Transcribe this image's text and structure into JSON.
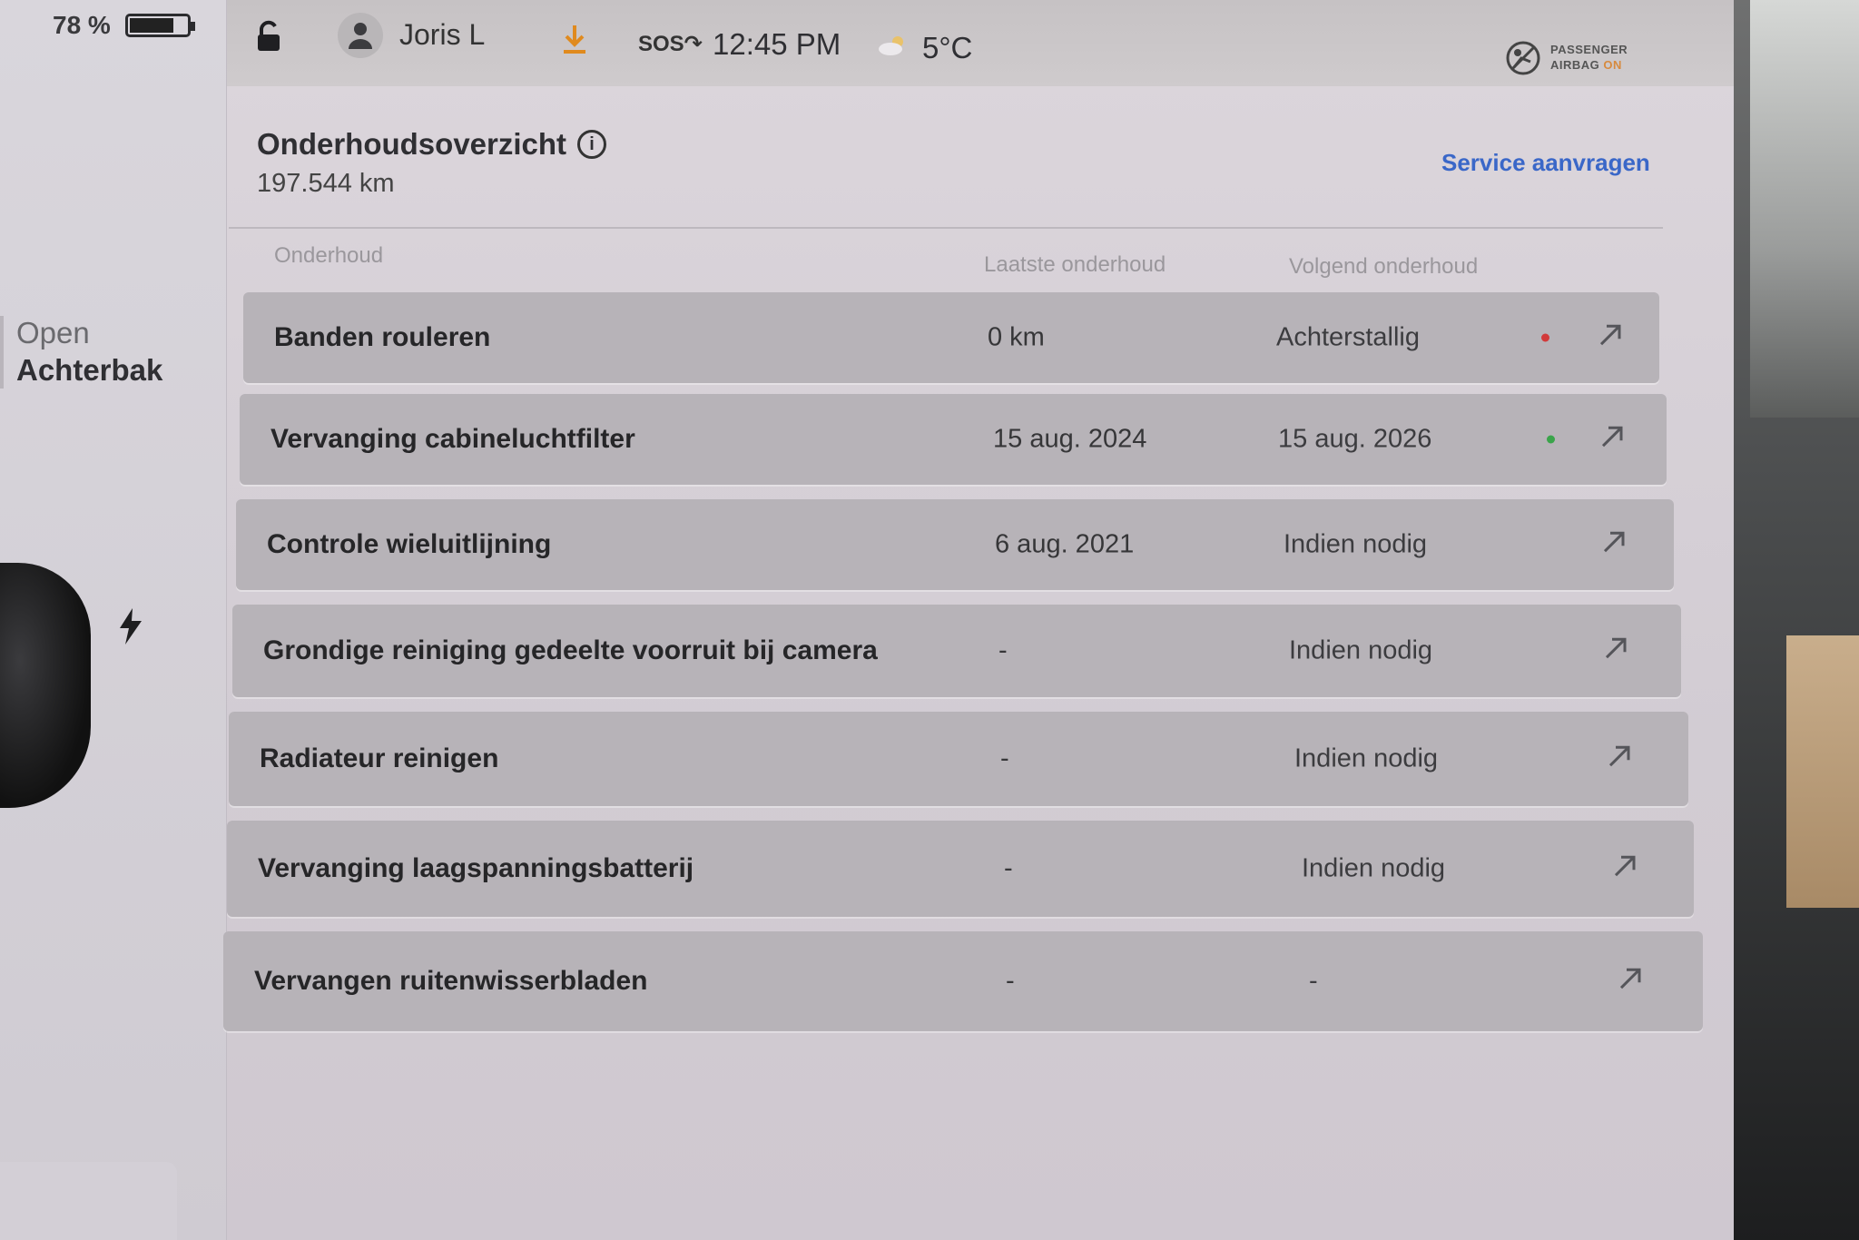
{
  "status": {
    "battery_percent": "78 %",
    "battery_level": 0.78,
    "user_name": "Joris L",
    "sos_label": "SOS",
    "time": "12:45 PM",
    "temperature": "5°C",
    "airbag_line1": "PASSENGER",
    "airbag_line2": "AIRBAG",
    "airbag_state": "ON"
  },
  "left_panel": {
    "trunk_action": "Open",
    "trunk_name": "Achterbak"
  },
  "header": {
    "title": "Onderhoudsoverzicht",
    "odometer": "197.544  km",
    "service_link": "Service aanvragen"
  },
  "columns": {
    "task": "Onderhoud",
    "last": "Laatste onderhoud",
    "next": "Volgend onderhoud"
  },
  "rows": [
    {
      "task": "Banden rouleren",
      "last": "0 km",
      "next": "Achterstallig",
      "status_color": "#d23a3a"
    },
    {
      "task": "Vervanging cabineluchtfilter",
      "last": "15 aug. 2024",
      "next": "15 aug. 2026",
      "status_color": "#3aa44a"
    },
    {
      "task": "Controle wieluitlijning",
      "last": "6 aug. 2021",
      "next": "Indien nodig",
      "status_color": ""
    },
    {
      "task": "Grondige reiniging gedeelte voorruit bij camera",
      "last": "-",
      "next": "Indien nodig",
      "status_color": ""
    },
    {
      "task": "Radiateur reinigen",
      "last": "-",
      "next": "Indien nodig",
      "status_color": ""
    },
    {
      "task": "Vervanging laagspanningsbatterij",
      "last": "-",
      "next": "Indien nodig",
      "status_color": ""
    },
    {
      "task": "Vervangen ruitenwisserbladen",
      "last": "-",
      "next": "-",
      "status_color": ""
    }
  ]
}
